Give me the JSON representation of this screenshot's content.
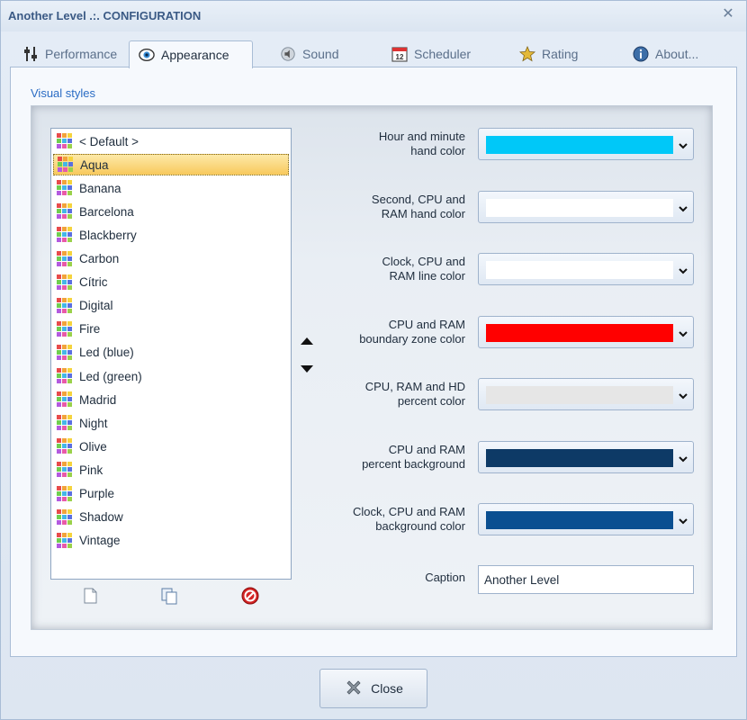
{
  "window": {
    "title": "Another Level .:. CONFIGURATION",
    "close_glyph": "✕"
  },
  "tabs": [
    {
      "label": "Performance",
      "icon": "sliders-icon",
      "active": false
    },
    {
      "label": "Appearance",
      "icon": "eye-icon",
      "active": true
    },
    {
      "label": "Sound",
      "icon": "speaker-icon",
      "active": false
    },
    {
      "label": "Scheduler",
      "icon": "calendar-icon",
      "active": false
    },
    {
      "label": "Rating",
      "icon": "star-icon",
      "active": false
    },
    {
      "label": "About...",
      "icon": "info-icon",
      "active": false
    }
  ],
  "calendar_icon_text": "12",
  "visual_styles": {
    "group_label": "Visual styles",
    "styles": [
      "< Default >",
      "Aqua",
      "Banana",
      "Barcelona",
      "Blackberry",
      "Carbon",
      "Cítric",
      "Digital",
      "Fire",
      "Led (blue)",
      "Led (green)",
      "Madrid",
      "Night",
      "Olive",
      "Pink",
      "Purple",
      "Shadow",
      "Vintage"
    ],
    "selected": "Aqua",
    "list_tools": [
      "new-style-icon",
      "copy-style-icon",
      "delete-style-icon"
    ],
    "move_buttons": [
      "move-up-icon",
      "move-down-icon"
    ]
  },
  "color_settings": [
    {
      "label_line1": "Hour and minute",
      "label_line2": "hand color",
      "color": "#00c8f8"
    },
    {
      "label_line1": "Second, CPU and",
      "label_line2": "RAM hand color",
      "color": "#ffffff"
    },
    {
      "label_line1": "Clock, CPU and",
      "label_line2": "RAM line color",
      "color": "#ffffff"
    },
    {
      "label_line1": "CPU and RAM",
      "label_line2": "boundary zone color",
      "color": "#ff0000"
    },
    {
      "label_line1": "CPU, RAM and HD",
      "label_line2": "percent color",
      "color": "#e6e6e6"
    },
    {
      "label_line1": "CPU and RAM",
      "label_line2": "percent background",
      "color": "#0d3a66"
    },
    {
      "label_line1": "Clock, CPU and RAM",
      "label_line2": "background color",
      "color": "#0a4f91"
    }
  ],
  "caption": {
    "label": "Caption",
    "value": "Another Level"
  },
  "footer": {
    "close_label": "Close"
  },
  "icon_grid_colors": [
    "#e84b4b",
    "#f2a33a",
    "#f5d33d",
    "#6fcf4f",
    "#44b6e8",
    "#5a6fe0",
    "#b35ae0",
    "#e85aa8",
    "#9ad14a"
  ]
}
